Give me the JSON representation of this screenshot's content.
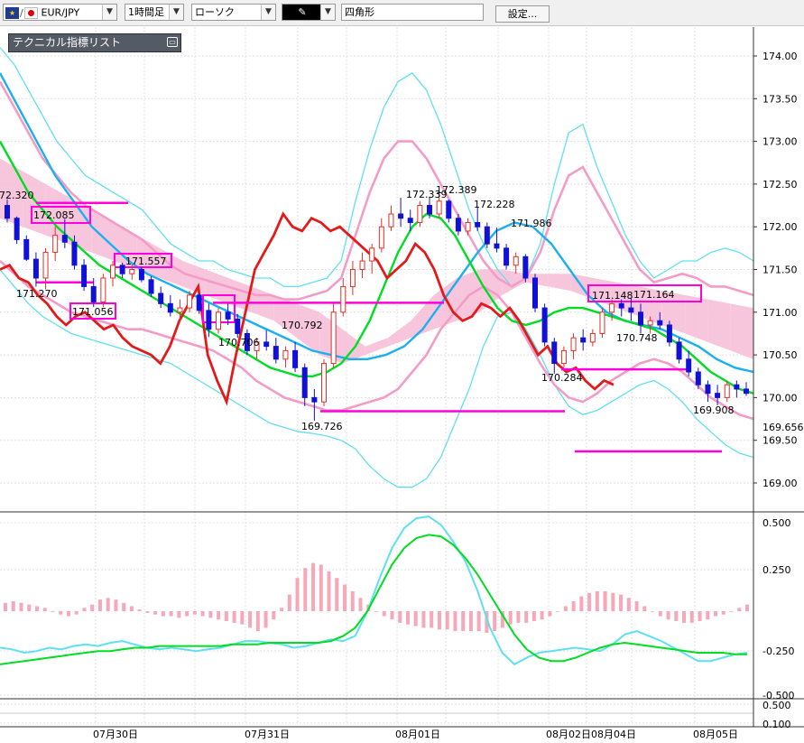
{
  "toolbar": {
    "symbol": "EUR/JPY",
    "symbol_icons": "flag-icons",
    "timeframe": "1時間足",
    "chart_style": "ローソク",
    "drawing_tool_icon": "pencil-icon",
    "drawing_shape": "四角形",
    "settings_label": "設定..."
  },
  "indicator_panel": {
    "title": "テクニカル指標リスト",
    "collapse_icon": "minimize-icon"
  },
  "colors": {
    "bull_candle": "#e0302a",
    "bear_candle": "#1010d8",
    "price_line": "#e31a1a",
    "bollinger_inner": "#f39cc8",
    "bollinger_outer": "#5fe0f0",
    "ma_fast": "#00dd22",
    "ma_slow": "#1ab0f0",
    "annotation": "#ff00dd",
    "cloud_bull": "#f7c0d8",
    "cloud_bear": "#b8d8f6",
    "macd_hist": "#f7a8b8",
    "grid": "#e0e0e0"
  },
  "chart_data": [
    {
      "type": "candlestick",
      "pair": "EUR/JPY",
      "y_axis_labels": [
        "174.00",
        "173.50",
        "173.00",
        "172.50",
        "172.00",
        "171.50",
        "171.00",
        "170.50",
        "170.00",
        "169.50",
        "169.00"
      ],
      "ylim": [
        168.75,
        174.35
      ],
      "grid": true,
      "x_axis_labels": [
        "07月30日",
        "07月31日",
        "08月01日",
        "08月02日",
        "08月04日",
        "08月05日"
      ],
      "current_price_label": "169.656",
      "price_annotations": [
        "172.320",
        "172.085",
        "171.557",
        "171.270",
        "171.056",
        "170.706",
        "170.792",
        "169.726",
        "172.339",
        "172.389",
        "172.228",
        "171.986",
        "171.148",
        "171.164",
        "170.748",
        "170.284",
        "169.908"
      ],
      "candles": [
        [
          172.25,
          172.32,
          172.05,
          172.1
        ],
        [
          172.1,
          172.12,
          171.8,
          171.85
        ],
        [
          171.85,
          171.9,
          171.6,
          171.62
        ],
        [
          171.62,
          171.7,
          171.3,
          171.4
        ],
        [
          171.4,
          171.75,
          171.27,
          171.7
        ],
        [
          171.7,
          172.0,
          171.6,
          171.9
        ],
        [
          171.9,
          172.09,
          171.75,
          171.82
        ],
        [
          171.82,
          171.9,
          171.5,
          171.55
        ],
        [
          171.55,
          171.62,
          171.25,
          171.3
        ],
        [
          171.3,
          171.4,
          171.06,
          171.12
        ],
        [
          171.12,
          171.45,
          171.06,
          171.4
        ],
        [
          171.4,
          171.6,
          171.3,
          171.55
        ],
        [
          171.55,
          171.58,
          171.4,
          171.45
        ],
        [
          171.45,
          171.56,
          171.38,
          171.5
        ],
        [
          171.5,
          171.53,
          171.35,
          171.38
        ],
        [
          171.38,
          171.42,
          171.18,
          171.22
        ],
        [
          171.22,
          171.3,
          171.05,
          171.1
        ],
        [
          171.1,
          171.2,
          170.95,
          171.0
        ],
        [
          171.0,
          171.15,
          170.9,
          171.05
        ],
        [
          171.05,
          171.25,
          171.0,
          171.2
        ],
        [
          171.2,
          171.22,
          170.98,
          171.02
        ],
        [
          171.02,
          171.1,
          170.71,
          170.8
        ],
        [
          170.8,
          171.05,
          170.75,
          171.0
        ],
        [
          171.0,
          171.1,
          170.85,
          170.92
        ],
        [
          170.92,
          170.98,
          170.7,
          170.75
        ],
        [
          170.75,
          170.8,
          170.5,
          170.55
        ],
        [
          170.55,
          170.7,
          170.45,
          170.65
        ],
        [
          170.65,
          170.79,
          170.55,
          170.6
        ],
        [
          170.6,
          170.7,
          170.4,
          170.45
        ],
        [
          170.45,
          170.6,
          170.35,
          170.55
        ],
        [
          170.55,
          170.65,
          170.3,
          170.35
        ],
        [
          170.35,
          170.4,
          169.9,
          170.0
        ],
        [
          170.0,
          170.1,
          169.73,
          169.95
        ],
        [
          169.95,
          170.45,
          169.9,
          170.4
        ],
        [
          170.4,
          171.1,
          170.35,
          171.0
        ],
        [
          171.0,
          171.4,
          170.95,
          171.3
        ],
        [
          171.3,
          171.6,
          171.2,
          171.5
        ],
        [
          171.5,
          171.7,
          171.4,
          171.6
        ],
        [
          171.6,
          171.8,
          171.45,
          171.75
        ],
        [
          171.75,
          172.1,
          171.7,
          172.0
        ],
        [
          172.0,
          172.25,
          171.95,
          172.15
        ],
        [
          172.15,
          172.34,
          172.0,
          172.1
        ],
        [
          172.1,
          172.2,
          171.95,
          172.05
        ],
        [
          172.05,
          172.3,
          172.0,
          172.25
        ],
        [
          172.25,
          172.35,
          172.1,
          172.15
        ],
        [
          172.15,
          172.39,
          172.1,
          172.3
        ],
        [
          172.3,
          172.32,
          172.05,
          172.1
        ],
        [
          172.1,
          172.15,
          171.9,
          171.95
        ],
        [
          171.95,
          172.1,
          171.9,
          172.05
        ],
        [
          172.05,
          172.23,
          171.95,
          172.0
        ],
        [
          172.0,
          172.05,
          171.75,
          171.8
        ],
        [
          171.8,
          171.99,
          171.7,
          171.75
        ],
        [
          171.75,
          171.8,
          171.5,
          171.55
        ],
        [
          171.55,
          171.7,
          171.45,
          171.65
        ],
        [
          171.65,
          171.68,
          171.35,
          171.4
        ],
        [
          171.4,
          171.45,
          171.0,
          171.05
        ],
        [
          171.05,
          171.1,
          170.6,
          170.65
        ],
        [
          170.65,
          170.7,
          170.28,
          170.4
        ],
        [
          170.4,
          170.6,
          170.35,
          170.55
        ],
        [
          170.55,
          170.75,
          170.45,
          170.7
        ],
        [
          170.7,
          170.8,
          170.55,
          170.65
        ],
        [
          170.65,
          170.8,
          170.6,
          170.75
        ],
        [
          170.75,
          171.05,
          170.7,
          171.0
        ],
        [
          171.0,
          171.15,
          170.9,
          171.1
        ],
        [
          171.1,
          171.15,
          170.95,
          171.05
        ],
        [
          171.05,
          171.16,
          170.9,
          171.0
        ],
        [
          171.0,
          171.1,
          170.75,
          170.85
        ],
        [
          170.85,
          170.95,
          170.75,
          170.9
        ],
        [
          170.9,
          171.0,
          170.8,
          170.85
        ],
        [
          170.85,
          170.9,
          170.6,
          170.65
        ],
        [
          170.65,
          170.7,
          170.4,
          170.45
        ],
        [
          170.45,
          170.55,
          170.25,
          170.3
        ],
        [
          170.3,
          170.35,
          170.1,
          170.15
        ],
        [
          170.15,
          170.2,
          169.95,
          170.05
        ],
        [
          170.05,
          170.15,
          169.91,
          170.0
        ],
        [
          170.0,
          170.2,
          169.95,
          170.15
        ],
        [
          170.15,
          170.2,
          170.0,
          170.1
        ],
        [
          170.1,
          170.18,
          170.02,
          170.05
        ]
      ],
      "price_line_series": [
        171.5,
        171.55,
        171.4,
        171.35,
        171.2,
        171.1,
        170.95,
        170.85,
        170.95,
        171.0,
        170.9,
        170.8,
        170.85,
        170.7,
        170.6,
        170.55,
        170.5,
        170.4,
        170.6,
        170.9,
        171.1,
        171.3,
        170.5,
        170.2,
        169.95,
        170.5,
        171.0,
        171.5,
        171.7,
        171.9,
        172.15,
        172.0,
        171.95,
        172.1,
        172.05,
        171.95,
        172.0,
        171.9,
        171.8,
        171.7,
        171.6,
        171.4,
        171.5,
        171.6,
        171.8,
        171.7,
        171.5,
        171.2,
        171.0,
        170.9,
        170.95,
        171.1,
        171.05,
        170.95,
        171.05,
        170.9,
        170.7,
        170.5,
        170.6,
        170.4,
        170.3,
        170.35,
        170.2,
        170.1,
        170.2,
        170.15
      ],
      "bollinger": {
        "outer_upper": [
          174.1,
          173.9,
          173.6,
          173.3,
          173.0,
          172.8,
          172.6,
          172.5,
          172.4,
          172.3,
          172.2,
          172.0,
          171.8,
          171.7,
          171.6,
          171.6,
          171.5,
          171.45,
          171.4,
          171.4,
          171.3,
          171.3,
          171.35,
          171.4,
          171.6,
          172.3,
          172.9,
          173.4,
          173.7,
          173.8,
          173.6,
          173.2,
          172.7,
          172.2,
          171.8,
          171.5,
          171.3,
          171.4,
          171.8,
          172.5,
          173.1,
          173.2,
          172.7,
          172.3,
          171.9,
          171.6,
          171.4,
          171.5,
          171.6,
          171.6,
          171.7,
          171.75,
          171.7,
          171.6
        ],
        "inner_upper": [
          173.7,
          173.4,
          173.1,
          172.8,
          172.6,
          172.4,
          172.25,
          172.15,
          172.05,
          171.95,
          171.85,
          171.7,
          171.55,
          171.45,
          171.4,
          171.35,
          171.3,
          171.25,
          171.2,
          171.2,
          171.15,
          171.15,
          171.2,
          171.25,
          171.4,
          171.9,
          172.4,
          172.8,
          173.0,
          173.0,
          172.8,
          172.5,
          172.2,
          171.9,
          171.6,
          171.4,
          171.3,
          171.4,
          171.7,
          172.2,
          172.6,
          172.7,
          172.4,
          172.1,
          171.8,
          171.5,
          171.35,
          171.4,
          171.45,
          171.4,
          171.3,
          171.3,
          171.25,
          171.2
        ],
        "inner_lower": [
          171.6,
          171.45,
          171.3,
          171.2,
          171.1,
          171.0,
          170.95,
          170.9,
          170.85,
          170.8,
          170.8,
          170.75,
          170.7,
          170.65,
          170.6,
          170.55,
          170.45,
          170.35,
          170.2,
          170.1,
          170.0,
          169.95,
          169.9,
          169.85,
          169.85,
          169.9,
          169.95,
          170.0,
          170.1,
          170.3,
          170.5,
          170.8,
          171.0,
          171.2,
          171.3,
          171.2,
          171.0,
          170.7,
          170.4,
          170.15,
          170.0,
          169.95,
          170.05,
          170.2,
          170.3,
          170.4,
          170.45,
          170.4,
          170.3,
          170.15,
          170.0,
          169.9,
          169.8,
          169.75
        ],
        "outer_lower": [
          171.5,
          171.3,
          171.1,
          170.95,
          170.85,
          170.75,
          170.7,
          170.65,
          170.6,
          170.55,
          170.5,
          170.45,
          170.4,
          170.3,
          170.2,
          170.1,
          170.0,
          169.9,
          169.8,
          169.7,
          169.65,
          169.6,
          169.58,
          169.55,
          169.5,
          169.4,
          169.2,
          169.05,
          168.95,
          168.95,
          169.05,
          169.3,
          169.7,
          170.1,
          170.6,
          170.95,
          171.0,
          170.8,
          170.5,
          170.15,
          169.9,
          169.8,
          169.85,
          169.95,
          170.05,
          170.15,
          170.2,
          170.1,
          169.95,
          169.75,
          169.6,
          169.45,
          169.35,
          169.3
        ]
      },
      "ma_fast": [
        173.0,
        172.7,
        172.4,
        172.2,
        172.0,
        171.85,
        171.7,
        171.55,
        171.45,
        171.35,
        171.25,
        171.15,
        171.05,
        170.95,
        170.85,
        170.75,
        170.65,
        170.55,
        170.45,
        170.35,
        170.3,
        170.25,
        170.25,
        170.3,
        170.4,
        170.6,
        170.9,
        171.3,
        171.7,
        172.0,
        172.15,
        172.1,
        171.9,
        171.6,
        171.3,
        171.05,
        170.9,
        170.85,
        170.9,
        171.0,
        171.05,
        171.05,
        171.0,
        170.95,
        170.9,
        170.85,
        170.8,
        170.7,
        170.6,
        170.45,
        170.3,
        170.2,
        170.1,
        170.05
      ],
      "ma_slow": [
        173.8,
        173.4,
        173.0,
        172.6,
        172.3,
        172.0,
        171.8,
        171.6,
        171.45,
        171.35,
        171.25,
        171.15,
        171.05,
        170.95,
        170.85,
        170.75,
        170.65,
        170.55,
        170.5,
        170.45,
        170.45,
        170.5,
        170.6,
        170.8,
        171.1,
        171.4,
        171.7,
        171.95,
        172.05,
        172.0,
        171.8,
        171.5,
        171.2,
        171.0,
        170.9,
        170.85,
        170.8,
        170.7,
        170.6,
        170.45,
        170.35,
        170.3
      ],
      "cloud_upper": [
        172.8,
        172.65,
        172.5,
        172.35,
        172.2,
        172.05,
        171.9,
        171.75,
        171.6,
        171.5,
        171.4,
        171.3,
        171.2,
        171.1,
        171.0,
        170.8,
        170.6,
        170.7,
        170.9,
        171.2,
        171.4,
        171.5,
        171.5,
        171.45,
        171.45,
        171.45,
        171.4,
        171.35,
        171.3,
        171.25,
        171.2,
        171.15,
        171.1,
        171.05
      ],
      "cloud_lower": [
        172.1,
        172.0,
        171.9,
        171.8,
        171.7,
        171.6,
        171.5,
        171.4,
        171.3,
        171.2,
        171.1,
        171.0,
        170.9,
        170.7,
        170.5,
        170.4,
        170.5,
        170.6,
        170.7,
        170.8,
        170.9,
        171.0,
        171.2,
        171.35,
        171.3,
        171.25,
        171.15,
        171.05,
        170.95,
        170.85,
        170.75,
        170.65,
        170.55,
        170.45
      ]
    },
    {
      "type": "histogram",
      "indicator": "MACD",
      "y_axis_labels": [
        "0.500",
        "0.250",
        "-0.250",
        "-0.500"
      ],
      "ylim": [
        -0.52,
        0.62
      ],
      "histogram": [
        0.05,
        0.06,
        0.05,
        0.04,
        0.03,
        0.02,
        0.0,
        -0.02,
        -0.03,
        -0.02,
        0.02,
        0.04,
        0.07,
        0.08,
        0.07,
        0.05,
        0.03,
        0.01,
        -0.01,
        -0.02,
        -0.03,
        -0.03,
        -0.04,
        -0.03,
        -0.02,
        -0.03,
        -0.04,
        -0.05,
        -0.06,
        -0.07,
        -0.08,
        -0.1,
        -0.12,
        -0.1,
        -0.05,
        0.02,
        0.1,
        0.2,
        0.26,
        0.29,
        0.28,
        0.24,
        0.2,
        0.16,
        0.12,
        0.08,
        0.04,
        0.0,
        -0.03,
        -0.05,
        -0.07,
        -0.08,
        -0.09,
        -0.1,
        -0.1,
        -0.11,
        -0.11,
        -0.12,
        -0.12,
        -0.12,
        -0.12,
        -0.13,
        -0.12,
        -0.1,
        -0.08,
        -0.07,
        -0.07,
        -0.06,
        -0.05,
        -0.03,
        0.0,
        0.03,
        0.06,
        0.09,
        0.11,
        0.12,
        0.12,
        0.11,
        0.1,
        0.08,
        0.06,
        0.03,
        0.0,
        -0.03,
        -0.05,
        -0.06,
        -0.07,
        -0.07,
        -0.06,
        -0.05,
        -0.03,
        -0.02,
        0.0,
        0.02,
        0.04
      ],
      "macd_line": [
        -0.22,
        -0.23,
        -0.25,
        -0.24,
        -0.22,
        -0.23,
        -0.21,
        -0.2,
        -0.21,
        -0.19,
        -0.18,
        -0.2,
        -0.22,
        -0.23,
        -0.22,
        -0.23,
        -0.24,
        -0.23,
        -0.22,
        -0.2,
        -0.18,
        -0.18,
        -0.19,
        -0.2,
        -0.22,
        -0.21,
        -0.19,
        -0.17,
        -0.18,
        -0.15,
        0.0,
        0.2,
        0.38,
        0.5,
        0.56,
        0.57,
        0.52,
        0.42,
        0.3,
        0.12,
        -0.1,
        -0.25,
        -0.32,
        -0.28,
        -0.25,
        -0.24,
        -0.23,
        -0.22,
        -0.23,
        -0.24,
        -0.2,
        -0.14,
        -0.12,
        -0.15,
        -0.18,
        -0.22,
        -0.26,
        -0.3,
        -0.3,
        -0.28,
        -0.26,
        -0.25
      ],
      "signal_line": [
        -0.32,
        -0.31,
        -0.3,
        -0.29,
        -0.28,
        -0.27,
        -0.26,
        -0.25,
        -0.24,
        -0.24,
        -0.23,
        -0.22,
        -0.22,
        -0.21,
        -0.21,
        -0.21,
        -0.21,
        -0.21,
        -0.21,
        -0.2,
        -0.2,
        -0.2,
        -0.19,
        -0.19,
        -0.19,
        -0.19,
        -0.19,
        -0.18,
        -0.15,
        -0.1,
        0.0,
        0.14,
        0.28,
        0.38,
        0.44,
        0.46,
        0.45,
        0.4,
        0.32,
        0.22,
        0.1,
        -0.02,
        -0.14,
        -0.23,
        -0.28,
        -0.3,
        -0.3,
        -0.28,
        -0.25,
        -0.22,
        -0.2,
        -0.19,
        -0.2,
        -0.21,
        -0.22,
        -0.23,
        -0.24,
        -0.25,
        -0.25,
        -0.25,
        -0.26,
        -0.26
      ]
    },
    {
      "type": "line",
      "indicator": "Stochastic",
      "y_axis_labels": [
        "0.500",
        "0.100"
      ],
      "ylim": [
        0.05,
        0.62
      ]
    }
  ]
}
